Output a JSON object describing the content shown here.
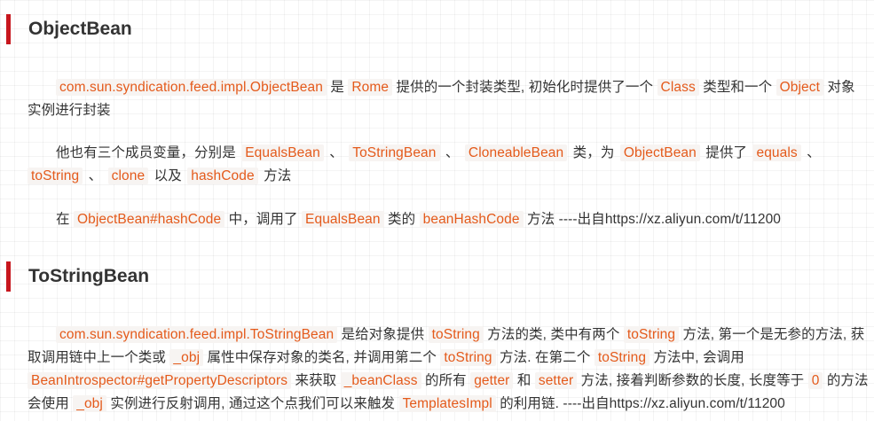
{
  "section1": {
    "title": "ObjectBean",
    "p1": {
      "code1": "com.sun.syndication.feed.impl.ObjectBean",
      "t1": " 是 ",
      "code2": "Rome",
      "t2": " 提供的一个封装类型, 初始化时提供了一个 ",
      "code3": "Class",
      "t3": " 类型和一个 ",
      "code4": "Object",
      "t4": " 对象实例进行封装"
    },
    "p2": {
      "t0": "他也有三个成员变量，分别是 ",
      "code1": "EqualsBean",
      "t1": " 、 ",
      "code2": "ToStringBean",
      "t2": " 、 ",
      "code3": "CloneableBean",
      "t3": " 类，为 ",
      "code4": "ObjectBean",
      "t4": " 提供了 ",
      "code5": "equals",
      "t5": " 、 ",
      "code6": "toString",
      "t6": " 、 ",
      "code7": "clone",
      "t7": " 以及 ",
      "code8": "hashCode",
      "t8": " 方法"
    },
    "p3": {
      "t0": "在 ",
      "code1": "ObjectBean#hashCode",
      "t1": " 中，调用了 ",
      "code2": "EqualsBean",
      "t2": " 类的 ",
      "code3": "beanHashCode",
      "t3": " 方法 ----出自https://xz.aliyun.com/t/11200"
    }
  },
  "section2": {
    "title": "ToStringBean",
    "p1": {
      "code1": "com.sun.syndication.feed.impl.ToStringBean",
      "t1": " 是给对象提供 ",
      "code2": "toString",
      "t2": " 方法的类, 类中有两个 ",
      "code3": "toString",
      "t3": " 方法, 第一个是无参的方法, 获取调用链中上一个类或 ",
      "code4": "_obj",
      "t4": " 属性中保存对象的类名, 并调用第二个 ",
      "code5": "toString",
      "t5": " 方法. 在第二个 ",
      "code6": "toString",
      "t6": " 方法中, 会调用 ",
      "code7": "BeanIntrospector#getPropertyDescriptors",
      "t7": " 来获取 ",
      "code8": "_beanClass",
      "t8": " 的所有 ",
      "code9": "getter",
      "t9": " 和 ",
      "code10": "setter",
      "t10": " 方法, 接着判断参数的长度, 长度等于 ",
      "code11": "0",
      "t11": " 的方法会使用 ",
      "code12": "_obj",
      "t12": " 实例进行反射调用, 通过这个点我们可以来触发 ",
      "code13": "TemplatesImpl",
      "t13": " 的利用链. ----出自https://xz.aliyun.com/t/11200"
    }
  }
}
